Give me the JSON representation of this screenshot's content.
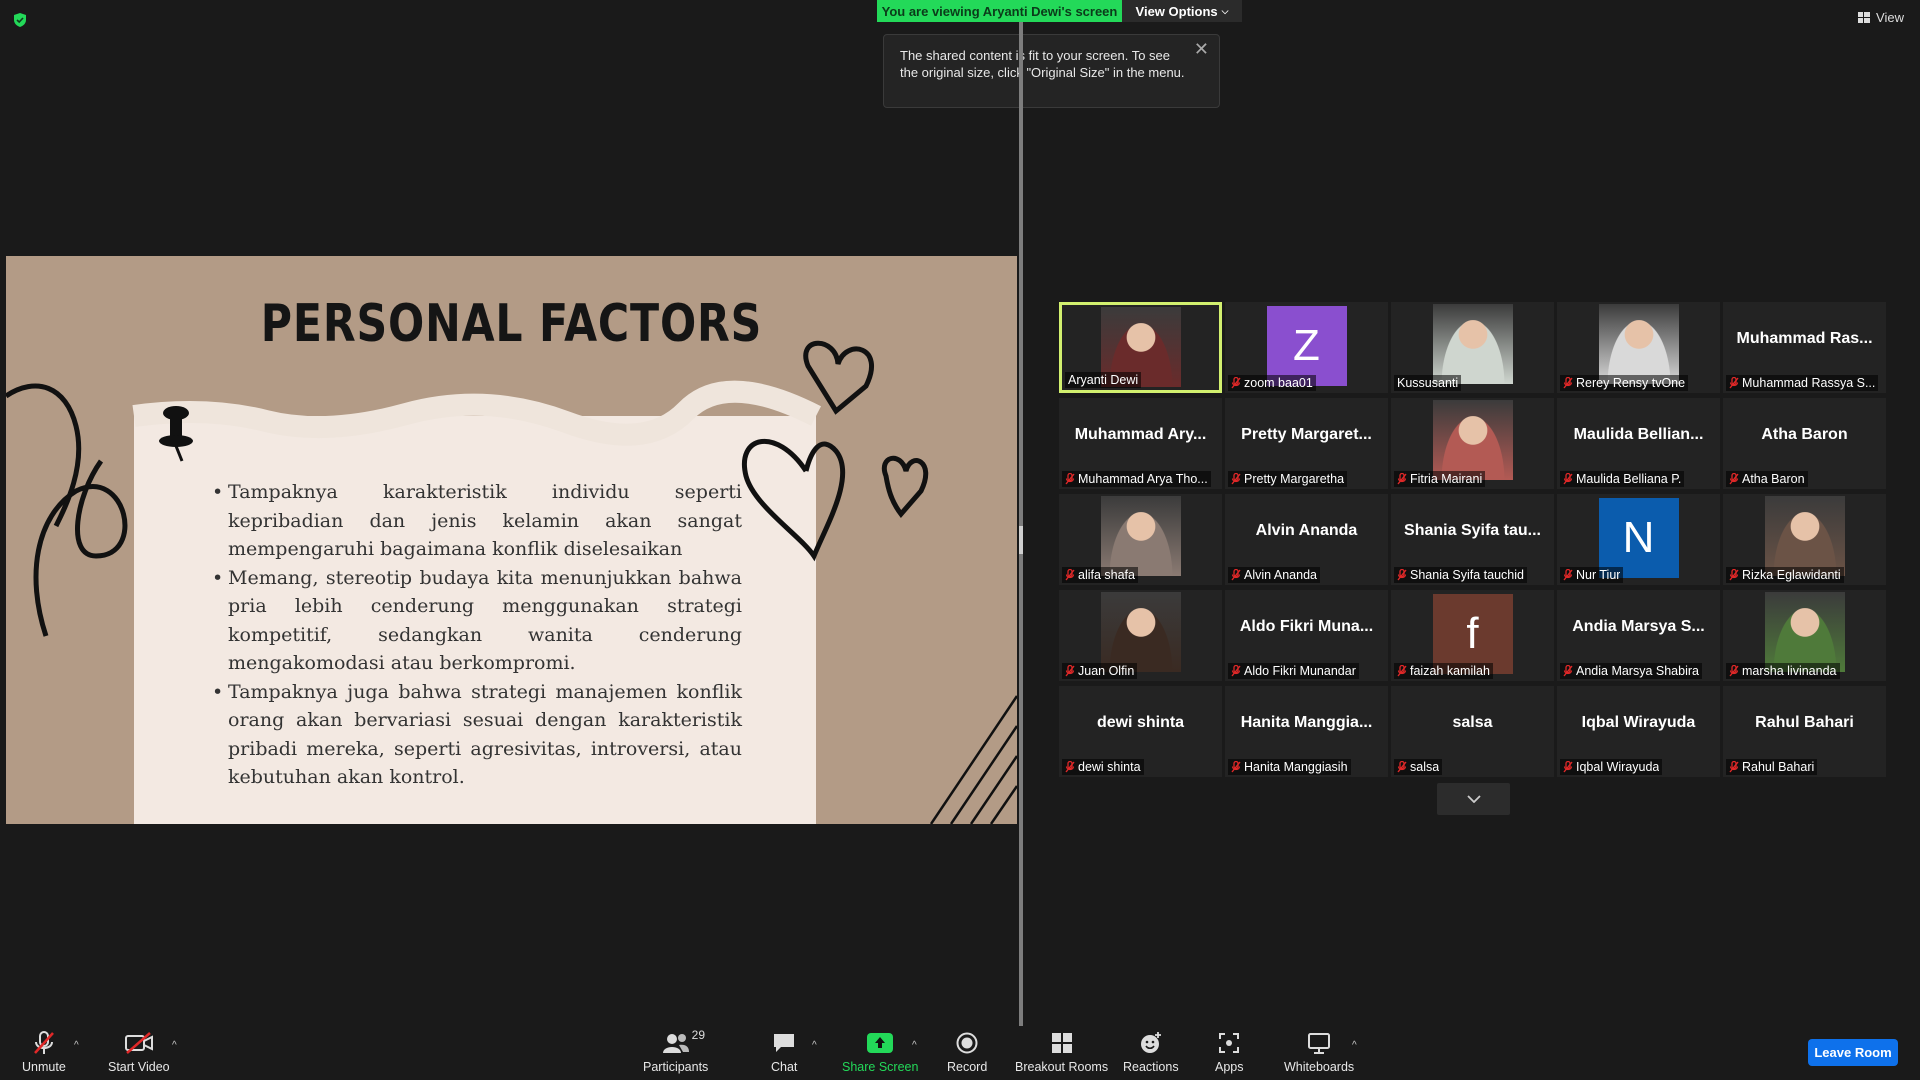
{
  "banner": {
    "viewing": "You are viewing Aryanti Dewi's screen",
    "view_options": "View Options"
  },
  "tooltip": {
    "text": "The shared content is fit to your screen. To see the original size, click \"Original Size\" in the menu."
  },
  "top_right": {
    "view": "View"
  },
  "slide": {
    "title": "PERSONAL FACTORS",
    "bullets": [
      "Tampaknya karakteristik individu seperti kepribadian dan jenis kelamin akan sangat mempengaruhi bagaimana konflik diselesaikan",
      "Memang, stereotip budaya kita menunjukkan bahwa pria lebih cenderung menggunakan strategi kompetitif, sedangkan wanita cenderung mengakomodasi atau berkompromi.",
      "Tampaknya juga bahwa strategi manajemen konflik orang akan bervariasi sesuai dengan karakteristik pribadi mereka, seperti agresivitas, introversi, atau kebutuhan akan kontrol."
    ]
  },
  "participants": [
    {
      "center": "",
      "label": "Aryanti Dewi",
      "muted": false,
      "type": "photo",
      "color": "#6a2b2b"
    },
    {
      "center": "",
      "label": "zoom baa01",
      "muted": true,
      "type": "letter",
      "letter": "Z",
      "color": "#8a4fcf"
    },
    {
      "center": "",
      "label": "Kussusanti",
      "muted": false,
      "type": "photo",
      "color": "#cfd6cf"
    },
    {
      "center": "",
      "label": "Rerey Rensy tvOne",
      "muted": true,
      "type": "photo",
      "color": "#d9d9d9"
    },
    {
      "center": "Muhammad Ras...",
      "label": "Muhammad Rassya S...",
      "muted": true,
      "type": "name"
    },
    {
      "center": "Muhammad Ary...",
      "label": "Muhammad Arya Tho...",
      "muted": true,
      "type": "name"
    },
    {
      "center": "Pretty Margaret...",
      "label": "Pretty Margaretha",
      "muted": true,
      "type": "name"
    },
    {
      "center": "",
      "label": "Fitria Mairani",
      "muted": true,
      "type": "photo",
      "color": "#b35a54"
    },
    {
      "center": "Maulida Bellian...",
      "label": "Maulida Belliana P.",
      "muted": true,
      "type": "name"
    },
    {
      "center": "Atha Baron",
      "label": "Atha Baron",
      "muted": true,
      "type": "name"
    },
    {
      "center": "",
      "label": "alifa shafa",
      "muted": true,
      "type": "photo",
      "color": "#8a7a72"
    },
    {
      "center": "Alvin Ananda",
      "label": "Alvin Ananda",
      "muted": true,
      "type": "name"
    },
    {
      "center": "Shania Syifa tau...",
      "label": "Shania Syifa tauchid",
      "muted": true,
      "type": "name"
    },
    {
      "center": "",
      "label": "Nur Tiur",
      "muted": true,
      "type": "letter",
      "letter": "N",
      "color": "#0b5cad"
    },
    {
      "center": "",
      "label": "Rizka Eglawidanti",
      "muted": true,
      "type": "photo",
      "color": "#6b5346"
    },
    {
      "center": "",
      "label": "Juan Olfin",
      "muted": true,
      "type": "photo",
      "color": "#3a2a22"
    },
    {
      "center": "Aldo Fikri Muna...",
      "label": "Aldo Fikri Munandar",
      "muted": true,
      "type": "name"
    },
    {
      "center": "",
      "label": "faizah kamilah",
      "muted": true,
      "type": "letter",
      "letter": "f",
      "color": "#6b3a2e"
    },
    {
      "center": "Andia Marsya S...",
      "label": "Andia Marsya Shabira",
      "muted": true,
      "type": "name"
    },
    {
      "center": "",
      "label": "marsha livinanda",
      "muted": true,
      "type": "photo",
      "color": "#4f7a3a"
    },
    {
      "center": "dewi shinta",
      "label": "dewi shinta",
      "muted": true,
      "type": "name"
    },
    {
      "center": "Hanita Manggia...",
      "label": "Hanita Manggiasih",
      "muted": true,
      "type": "name"
    },
    {
      "center": "salsa",
      "label": "salsa",
      "muted": true,
      "type": "name"
    },
    {
      "center": "Iqbal Wirayuda",
      "label": "Iqbal Wirayuda",
      "muted": true,
      "type": "name"
    },
    {
      "center": "Rahul Bahari",
      "label": "Rahul Bahari",
      "muted": true,
      "type": "name"
    }
  ],
  "toolbar": {
    "unmute": "Unmute",
    "start_video": "Start Video",
    "participants": "Participants",
    "participants_count": "29",
    "chat": "Chat",
    "share_screen": "Share Screen",
    "record": "Record",
    "breakout_rooms": "Breakout Rooms",
    "reactions": "Reactions",
    "apps": "Apps",
    "whiteboards": "Whiteboards",
    "leave": "Leave Room"
  },
  "colors": {
    "accent_green": "#23d959",
    "leave_blue": "#0e71eb",
    "active_border": "#d2f06f",
    "muted_red": "#e02828"
  }
}
